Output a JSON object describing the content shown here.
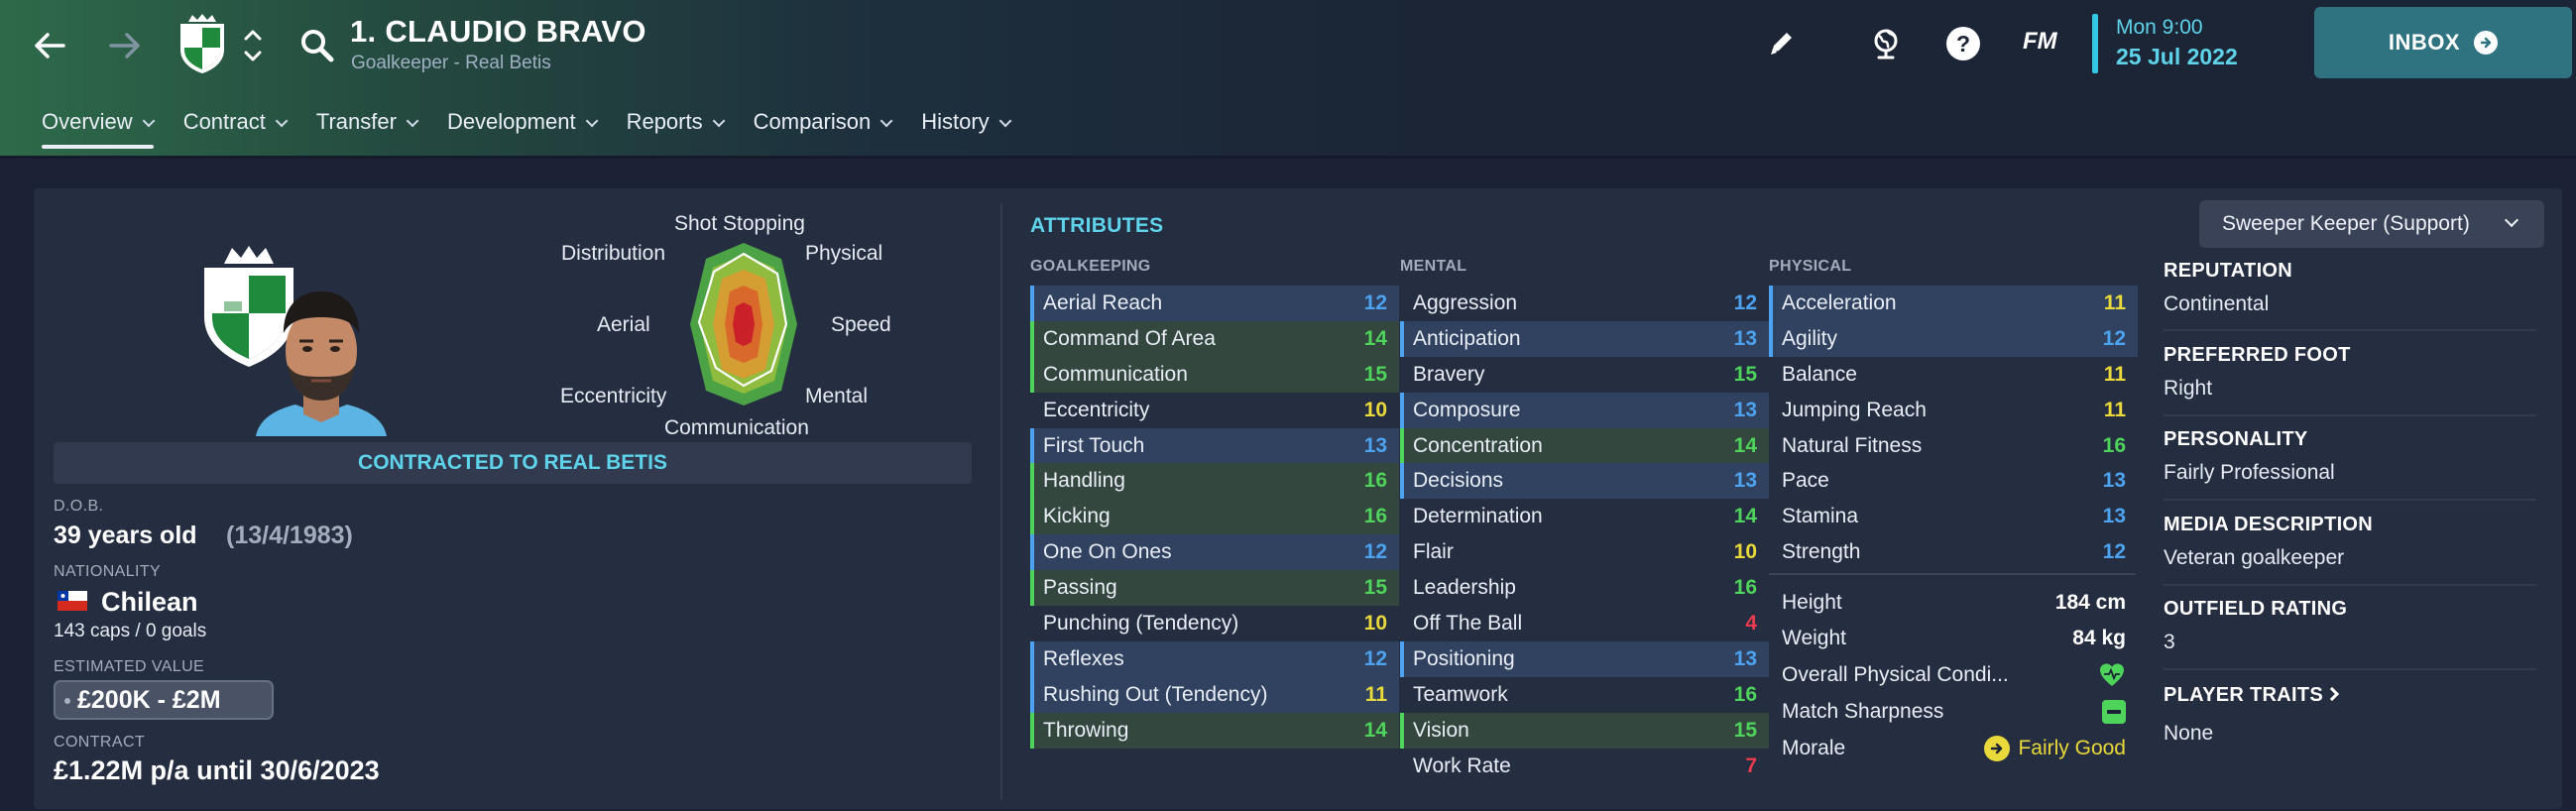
{
  "header": {
    "player_title": "1. CLAUDIO BRAVO",
    "player_subtitle": "Goalkeeper - Real Betis",
    "fm_logo": "FM",
    "date_time": "Mon 9:00",
    "date_day": "25 Jul 2022",
    "inbox_label": "INBOX"
  },
  "tabs": [
    {
      "label": "Overview"
    },
    {
      "label": "Contract"
    },
    {
      "label": "Transfer"
    },
    {
      "label": "Development"
    },
    {
      "label": "Reports"
    },
    {
      "label": "Comparison"
    },
    {
      "label": "History"
    }
  ],
  "polar": {
    "labels": [
      "Shot Stopping",
      "Physical",
      "Speed",
      "Mental",
      "Communication",
      "Eccentricity",
      "Aerial",
      "Distribution"
    ]
  },
  "profile": {
    "contract_banner": "CONTRACTED TO REAL BETIS",
    "dob_label": "D.O.B.",
    "dob_age": "39 years old",
    "dob_date": "(13/4/1983)",
    "nationality_label": "NATIONALITY",
    "nationality": "Chilean",
    "caps": "143 caps / 0 goals",
    "value_label": "ESTIMATED VALUE",
    "value": "£200K - £2M",
    "contract_label": "CONTRACT",
    "contract": "£1.22M p/a until 30/6/2023"
  },
  "attributes": {
    "title": "ATTRIBUTES",
    "goalkeeping_header": "GOALKEEPING",
    "mental_header": "MENTAL",
    "physical_header": "PHYSICAL",
    "goalkeeping": [
      {
        "name": "Aerial Reach",
        "value": "12"
      },
      {
        "name": "Command Of Area",
        "value": "14"
      },
      {
        "name": "Communication",
        "value": "15"
      },
      {
        "name": "Eccentricity",
        "value": "10"
      },
      {
        "name": "First Touch",
        "value": "13"
      },
      {
        "name": "Handling",
        "value": "16"
      },
      {
        "name": "Kicking",
        "value": "16"
      },
      {
        "name": "One On Ones",
        "value": "12"
      },
      {
        "name": "Passing",
        "value": "15"
      },
      {
        "name": "Punching (Tendency)",
        "value": "10"
      },
      {
        "name": "Reflexes",
        "value": "12"
      },
      {
        "name": "Rushing Out (Tendency)",
        "value": "11"
      },
      {
        "name": "Throwing",
        "value": "14"
      }
    ],
    "mental": [
      {
        "name": "Aggression",
        "value": "12"
      },
      {
        "name": "Anticipation",
        "value": "13"
      },
      {
        "name": "Bravery",
        "value": "15"
      },
      {
        "name": "Composure",
        "value": "13"
      },
      {
        "name": "Concentration",
        "value": "14"
      },
      {
        "name": "Decisions",
        "value": "13"
      },
      {
        "name": "Determination",
        "value": "14"
      },
      {
        "name": "Flair",
        "value": "10"
      },
      {
        "name": "Leadership",
        "value": "16"
      },
      {
        "name": "Off The Ball",
        "value": "4"
      },
      {
        "name": "Positioning",
        "value": "13"
      },
      {
        "name": "Teamwork",
        "value": "16"
      },
      {
        "name": "Vision",
        "value": "15"
      },
      {
        "name": "Work Rate",
        "value": "7"
      }
    ],
    "physical": [
      {
        "name": "Acceleration",
        "value": "11"
      },
      {
        "name": "Agility",
        "value": "12"
      },
      {
        "name": "Balance",
        "value": "11"
      },
      {
        "name": "Jumping Reach",
        "value": "11"
      },
      {
        "name": "Natural Fitness",
        "value": "16"
      },
      {
        "name": "Pace",
        "value": "13"
      },
      {
        "name": "Stamina",
        "value": "13"
      },
      {
        "name": "Strength",
        "value": "12"
      }
    ],
    "height_label": "Height",
    "height": "184 cm",
    "weight_label": "Weight",
    "weight": "84 kg",
    "condition_label": "Overall Physical Condi...",
    "sharpness_label": "Match Sharpness",
    "morale_label": "Morale",
    "morale": "Fairly Good"
  },
  "info": {
    "role": "Sweeper Keeper (Support)",
    "reputation_label": "REPUTATION",
    "reputation": "Continental",
    "foot_label": "PREFERRED FOOT",
    "foot": "Right",
    "personality_label": "PERSONALITY",
    "personality": "Fairly Professional",
    "media_label": "MEDIA DESCRIPTION",
    "media": "Veteran goalkeeper",
    "outfield_label": "OUTFIELD RATING",
    "outfield": "3",
    "traits_label": "PLAYER TRAITS",
    "traits": "None"
  },
  "colors": {
    "accent": "#5fd3ea",
    "rating_blue": "#4da3ef",
    "rating_green": "#4ed35b",
    "rating_yellow": "#e9d93a",
    "rating_red": "#ea3b4f"
  }
}
